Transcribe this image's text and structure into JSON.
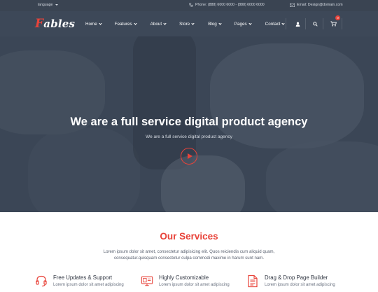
{
  "topbar": {
    "language": "language",
    "phone": "Phone: (888) 6000 6000 - (888) 6000 6000",
    "email": "Email: Design@domain.com"
  },
  "header": {
    "logo_initial": "F",
    "logo_rest": "ables",
    "nav": [
      {
        "label": "Home"
      },
      {
        "label": "Features"
      },
      {
        "label": "About"
      },
      {
        "label": "Store"
      },
      {
        "label": "Blog"
      },
      {
        "label": "Pages"
      },
      {
        "label": "Contact"
      }
    ],
    "cart_count": "0",
    "icons": [
      "user-icon",
      "search-icon",
      "cart-icon"
    ]
  },
  "hero": {
    "title": "We are a full service digital product agency",
    "subtitle": "We are a full service digital product agency",
    "play_icon": "play-icon"
  },
  "services": {
    "title": "Our Services",
    "description_line1": "Lorem ipsum dolor sit amet, consectetur adipisicing elit. Quos reiciendis cum aliquid quam,",
    "description_line2": "consequatur.quisquam consectetur culpa commodi maxime in harum sunt nam.",
    "items": [
      {
        "icon": "headset-icon",
        "title": "Free Updates & Support",
        "text": "Lorem ipsum dolor sit amet adipiscing"
      },
      {
        "icon": "monitor-icon",
        "title": "Highly Customizable",
        "text": "Lorem ipsum dolor sit amet adipiscing"
      },
      {
        "icon": "document-icon",
        "title": "Drag & Drop Page Builder",
        "text": "Lorem ipsum dolor sit amet adipiscing"
      }
    ]
  },
  "colors": {
    "accent": "#e8433a",
    "topbar": "#3a4452",
    "header": "#3d4858",
    "hero_overlay": "#2d3848"
  }
}
